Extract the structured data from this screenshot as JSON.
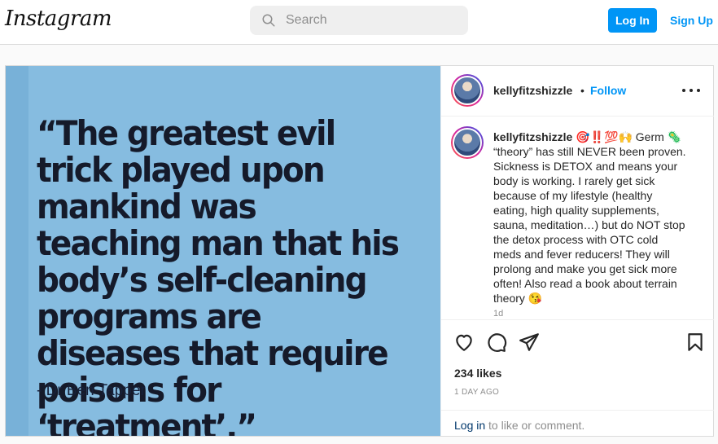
{
  "header": {
    "logo": "Instagram",
    "search_placeholder": "Search",
    "login_label": "Log In",
    "signup_label": "Sign Up"
  },
  "post": {
    "image": {
      "quote": "“The greatest evil trick played upon mankind was teaching man that his body’s self-cleaning programs are diseases that require poisons for ‘treatment’.”",
      "author": "- Dr Ben Tapper",
      "background_color": "#86bce0"
    },
    "header": {
      "username": "kellyfitzshizzle",
      "separator": "•",
      "follow_label": "Follow"
    },
    "caption": {
      "username": "kellyfitzshizzle",
      "text": "🎯‼️💯🙌 Germ 🦠 “theory” has still NEVER been proven. Sickness is DETOX and means your body is working. I rarely get sick because of my lifestyle (healthy eating, high quality supplements, sauna, meditation…) but do NOT stop the detox process with OTC cold meds and fever reducers! They will prolong and make you get sick more often! Also read a book about terrain theory 😘",
      "time": "1d"
    },
    "actions": {
      "icons": [
        "heart-icon",
        "comment-icon",
        "share-icon",
        "bookmark-icon"
      ]
    },
    "likes": "234 likes",
    "posted_ago": "1 DAY AGO",
    "comment_prompt": {
      "link": "Log in",
      "rest": " to like or comment."
    }
  },
  "colors": {
    "accent": "#0095f6",
    "text": "#262626",
    "muted": "#8e8e8e"
  }
}
